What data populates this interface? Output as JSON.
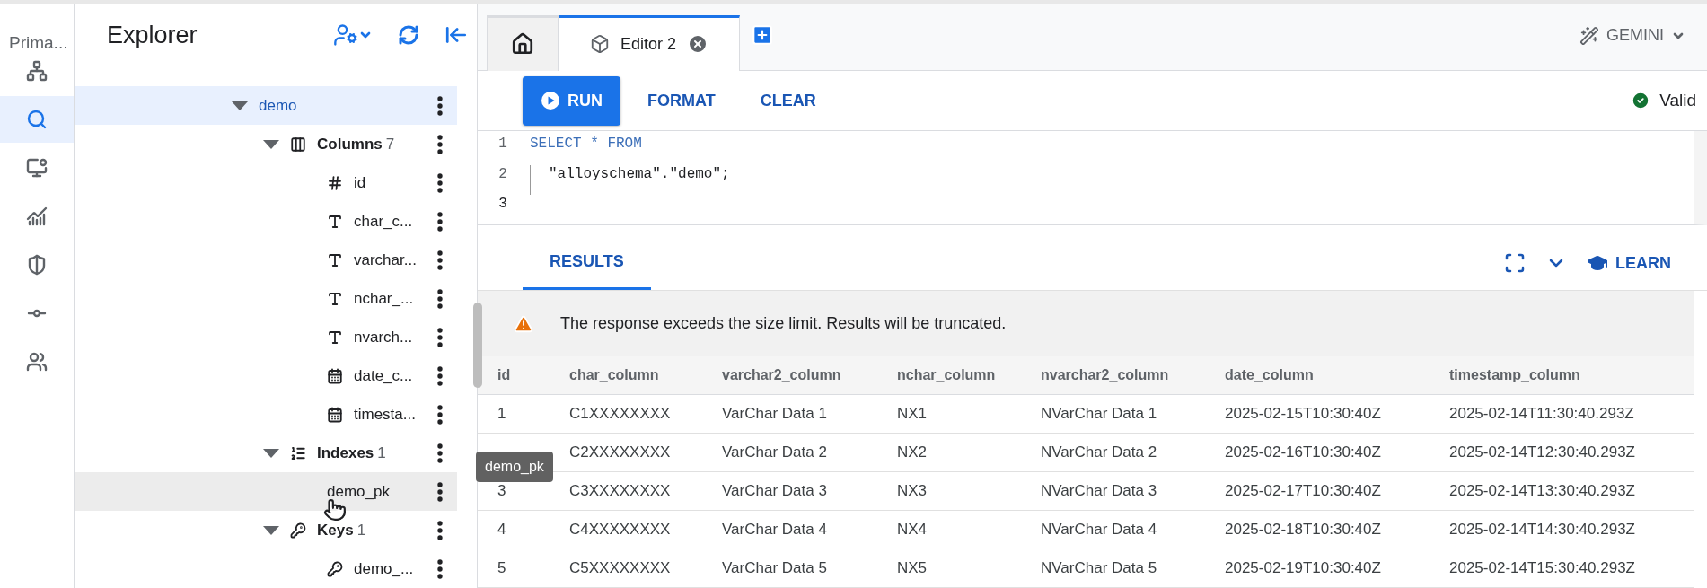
{
  "rail": {
    "title": "Prima...",
    "items": [
      {
        "kind": "schema",
        "selected": false
      },
      {
        "kind": "search",
        "selected": true
      },
      {
        "kind": "monitor",
        "selected": false
      },
      {
        "kind": "chart",
        "selected": false
      },
      {
        "kind": "shield",
        "selected": false
      },
      {
        "kind": "commit",
        "selected": false
      },
      {
        "kind": "people",
        "selected": false
      }
    ]
  },
  "explorer": {
    "title": "Explorer",
    "tree": [
      {
        "label": "demo",
        "expanded": true,
        "selected": true,
        "hovered": false,
        "children": [
          {
            "label": "Columns",
            "count": "7",
            "kind": "group-columns",
            "expanded": true,
            "selected": false,
            "hovered": false,
            "children": [
              {
                "label": "id",
                "kind": "number",
                "selected": false,
                "hovered": false
              },
              {
                "label": "char_c...",
                "kind": "text",
                "selected": false,
                "hovered": false
              },
              {
                "label": "varchar...",
                "kind": "text",
                "selected": false,
                "hovered": false
              },
              {
                "label": "nchar_...",
                "kind": "text",
                "selected": false,
                "hovered": false
              },
              {
                "label": "nvarch...",
                "kind": "text",
                "selected": false,
                "hovered": false
              },
              {
                "label": "date_c...",
                "kind": "date",
                "selected": false,
                "hovered": false
              },
              {
                "label": "timesta...",
                "kind": "date",
                "selected": false,
                "hovered": false
              }
            ]
          },
          {
            "label": "Indexes",
            "count": "1",
            "kind": "group-indexes",
            "expanded": true,
            "selected": false,
            "hovered": false,
            "children": [
              {
                "label": "demo_pk",
                "kind": "index",
                "selected": false,
                "hovered": true
              }
            ]
          },
          {
            "label": "Keys",
            "count": "1",
            "kind": "group-keys",
            "expanded": true,
            "selected": false,
            "hovered": false,
            "children": [
              {
                "label": "demo_...",
                "kind": "key",
                "selected": false,
                "hovered": false
              }
            ]
          }
        ]
      }
    ]
  },
  "tooltip": "demo_pk",
  "tabs": [
    {
      "kind": "home",
      "selected": false
    },
    {
      "kind": "editor",
      "label": "Editor 2",
      "selected": true
    }
  ],
  "gemini": "GEMINI",
  "toolbar": {
    "buttons": [
      {
        "label": "RUN",
        "kind": "primary"
      },
      {
        "label": "FORMAT",
        "kind": "text"
      },
      {
        "label": "CLEAR",
        "kind": "text"
      }
    ],
    "status": "Valid"
  },
  "editor": {
    "lines": [
      {
        "number": "1",
        "code": "SELECT * FROM",
        "kind": "keyword",
        "current": false
      },
      {
        "number": "2",
        "code": "\"alloyschema\".\"demo\";",
        "kind": "plain",
        "current": false
      },
      {
        "number": "3",
        "current": true
      }
    ]
  },
  "results": {
    "tabs": [
      {
        "label": "RESULTS",
        "selected": true
      }
    ],
    "learn": "LEARN",
    "warning": "The response exceeds the size limit. Results will be truncated.",
    "columns": [
      "id",
      "char_column",
      "varchar2_column",
      "nchar_column",
      "nvarchar2_column",
      "date_column",
      "timestamp_column"
    ],
    "rows": [
      [
        "1",
        "C1XXXXXXXX",
        "VarChar Data 1",
        "NX1",
        "NVarChar Data 1",
        "2025-02-15T10:30:40Z",
        "2025-02-14T11:30:40.293Z"
      ],
      [
        null,
        "C2XXXXXXXX",
        "VarChar Data 2",
        "NX2",
        "NVarChar Data 2",
        "2025-02-16T10:30:40Z",
        "2025-02-14T12:30:40.293Z"
      ],
      [
        "3",
        "C3XXXXXXXX",
        "VarChar Data 3",
        "NX3",
        "NVarChar Data 3",
        "2025-02-17T10:30:40Z",
        "2025-02-14T13:30:40.293Z"
      ],
      [
        "4",
        "C4XXXXXXXX",
        "VarChar Data 4",
        "NX4",
        "NVarChar Data 4",
        "2025-02-18T10:30:40Z",
        "2025-02-14T14:30:40.293Z"
      ],
      [
        "5",
        "C5XXXXXXXX",
        "VarChar Data 5",
        "NX5",
        "NVarChar Data 5",
        "2025-02-19T10:30:40Z",
        "2025-02-14T15:30:40.293Z"
      ]
    ]
  }
}
